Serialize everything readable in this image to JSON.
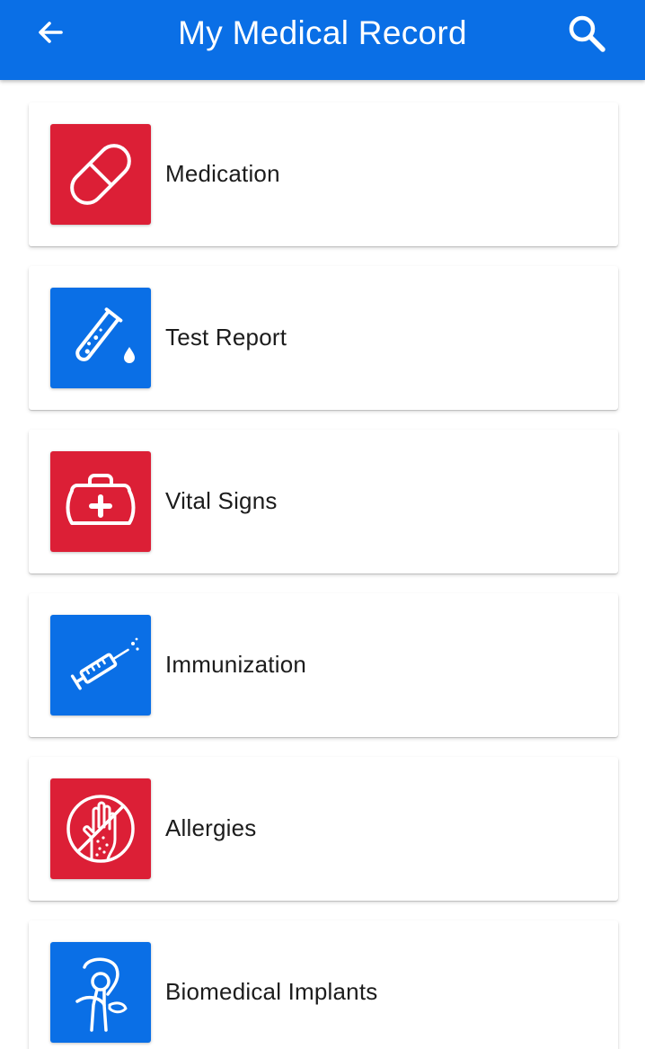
{
  "header": {
    "title": "My Medical Record",
    "back_icon": "arrow-left-icon",
    "search_icon": "search-icon",
    "background_color": "#0a6fe6"
  },
  "items": [
    {
      "label": "Medication",
      "icon": "pill-capsule-icon",
      "tile_color": "#dc1f36"
    },
    {
      "label": "Test Report",
      "icon": "test-tube-icon",
      "tile_color": "#0a6fe6"
    },
    {
      "label": "Vital Signs",
      "icon": "medical-bag-icon",
      "tile_color": "#dc1f36"
    },
    {
      "label": "Immunization",
      "icon": "syringe-icon",
      "tile_color": "#0a6fe6"
    },
    {
      "label": "Allergies",
      "icon": "allergy-hand-icon",
      "tile_color": "#dc1f36"
    },
    {
      "label": "Biomedical Implants",
      "icon": "hip-implant-icon",
      "tile_color": "#0a6fe6"
    }
  ]
}
